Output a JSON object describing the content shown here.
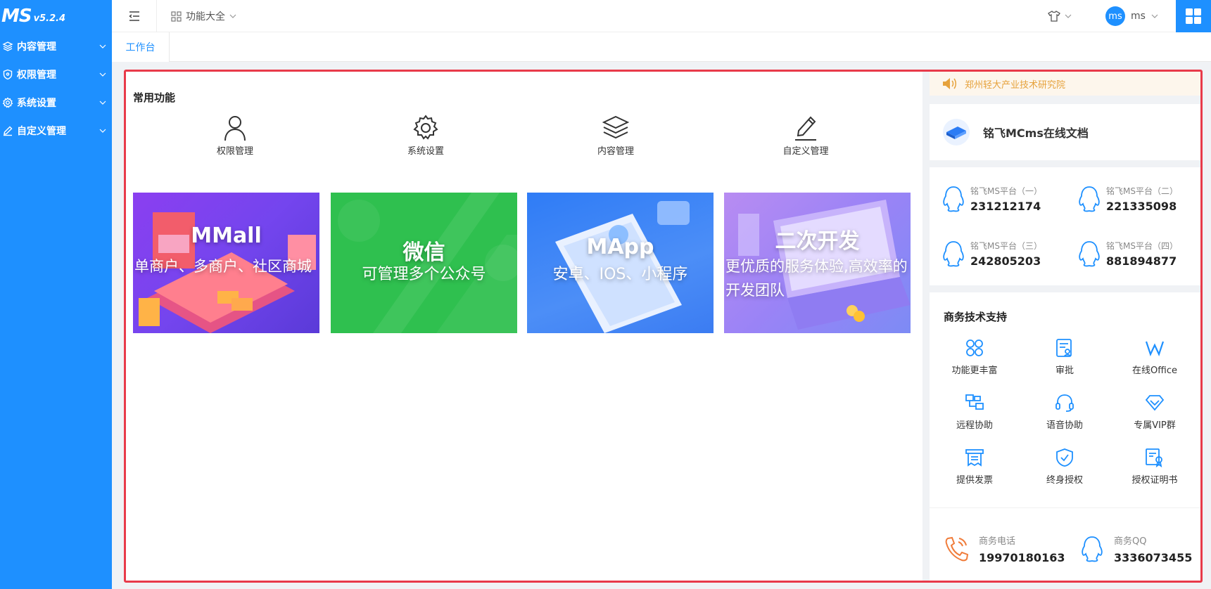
{
  "sidebar": {
    "logo": "MS",
    "version": "v5.2.4",
    "items": [
      {
        "label": "内容管理"
      },
      {
        "label": "权限管理"
      },
      {
        "label": "系统设置"
      },
      {
        "label": "自定义管理"
      }
    ]
  },
  "header": {
    "functions_label": "功能大全",
    "user_avatar": "ms",
    "user_name": "ms"
  },
  "tabs": [
    {
      "label": "工作台"
    }
  ],
  "main": {
    "common_title": "常用功能",
    "quick": [
      {
        "label": "权限管理",
        "icon": "user-icon"
      },
      {
        "label": "系统设置",
        "icon": "gear-icon"
      },
      {
        "label": "内容管理",
        "icon": "layers-icon"
      },
      {
        "label": "自定义管理",
        "icon": "edit-icon"
      }
    ],
    "cards": [
      {
        "title": "MMall",
        "subtitle": "单商户、多商户、社区商城",
        "color": "#7b4df0"
      },
      {
        "title": "微信",
        "subtitle": "可管理多个公众号",
        "color": "#2fc04f"
      },
      {
        "title": "MApp",
        "subtitle": "安卓、IOS、小程序",
        "color": "#3d86f5"
      },
      {
        "title": "二次开发",
        "subtitle": "更优质的服务体验,高效率的开发团队",
        "color": "#a58bf5"
      }
    ]
  },
  "right": {
    "notice": "郑州轻大产业技术研究院",
    "doc_title": "铭飞MCms在线文档",
    "qq_groups": [
      {
        "name": "铭飞MS平台（一）",
        "number": "231212174"
      },
      {
        "name": "铭飞MS平台（二）",
        "number": "221335098"
      },
      {
        "name": "铭飞MS平台（三）",
        "number": "242805203"
      },
      {
        "name": "铭飞MS平台（四）",
        "number": "881894877"
      }
    ],
    "support_title": "商务技术支持",
    "support_items": [
      {
        "label": "功能更丰富",
        "icon": "grid-icon"
      },
      {
        "label": "审批",
        "icon": "approval-icon"
      },
      {
        "label": "在线Office",
        "icon": "office-icon"
      },
      {
        "label": "远程协助",
        "icon": "remote-icon"
      },
      {
        "label": "语音协助",
        "icon": "headset-icon"
      },
      {
        "label": "专属VIP群",
        "icon": "diamond-icon"
      },
      {
        "label": "提供发票",
        "icon": "invoice-icon"
      },
      {
        "label": "终身授权",
        "icon": "shield-check-icon"
      },
      {
        "label": "授权证明书",
        "icon": "certificate-icon"
      }
    ],
    "phone_label": "商务电话",
    "phone_value": "19970180163",
    "qq_label": "商务QQ",
    "qq_value": "3336073455"
  },
  "colors": {
    "accent": "#1e90ff",
    "frame": "#e83a4a",
    "notice": "#e6a23c"
  }
}
